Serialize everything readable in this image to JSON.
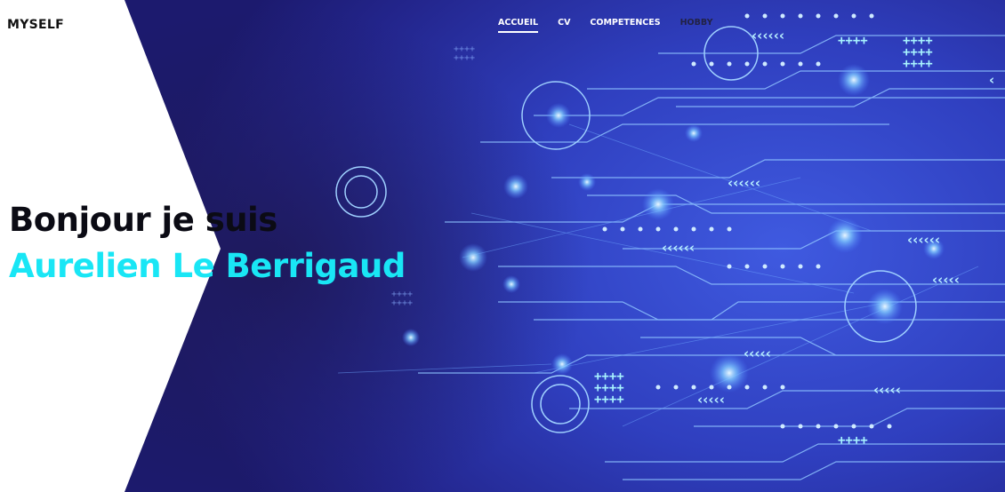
{
  "header": {
    "brand": "MYSELF",
    "nav": [
      {
        "label": "ACCUEIL",
        "active": true
      },
      {
        "label": "CV",
        "active": false
      },
      {
        "label": "COMPETENCES",
        "active": false
      },
      {
        "label": "HOBBY",
        "active": false
      }
    ]
  },
  "hero": {
    "greeting": "Bonjour je suis",
    "name": "Aurelien Le Berrigaud",
    "name_color": "#19e6f5",
    "background": "circuit-board-illustration"
  }
}
